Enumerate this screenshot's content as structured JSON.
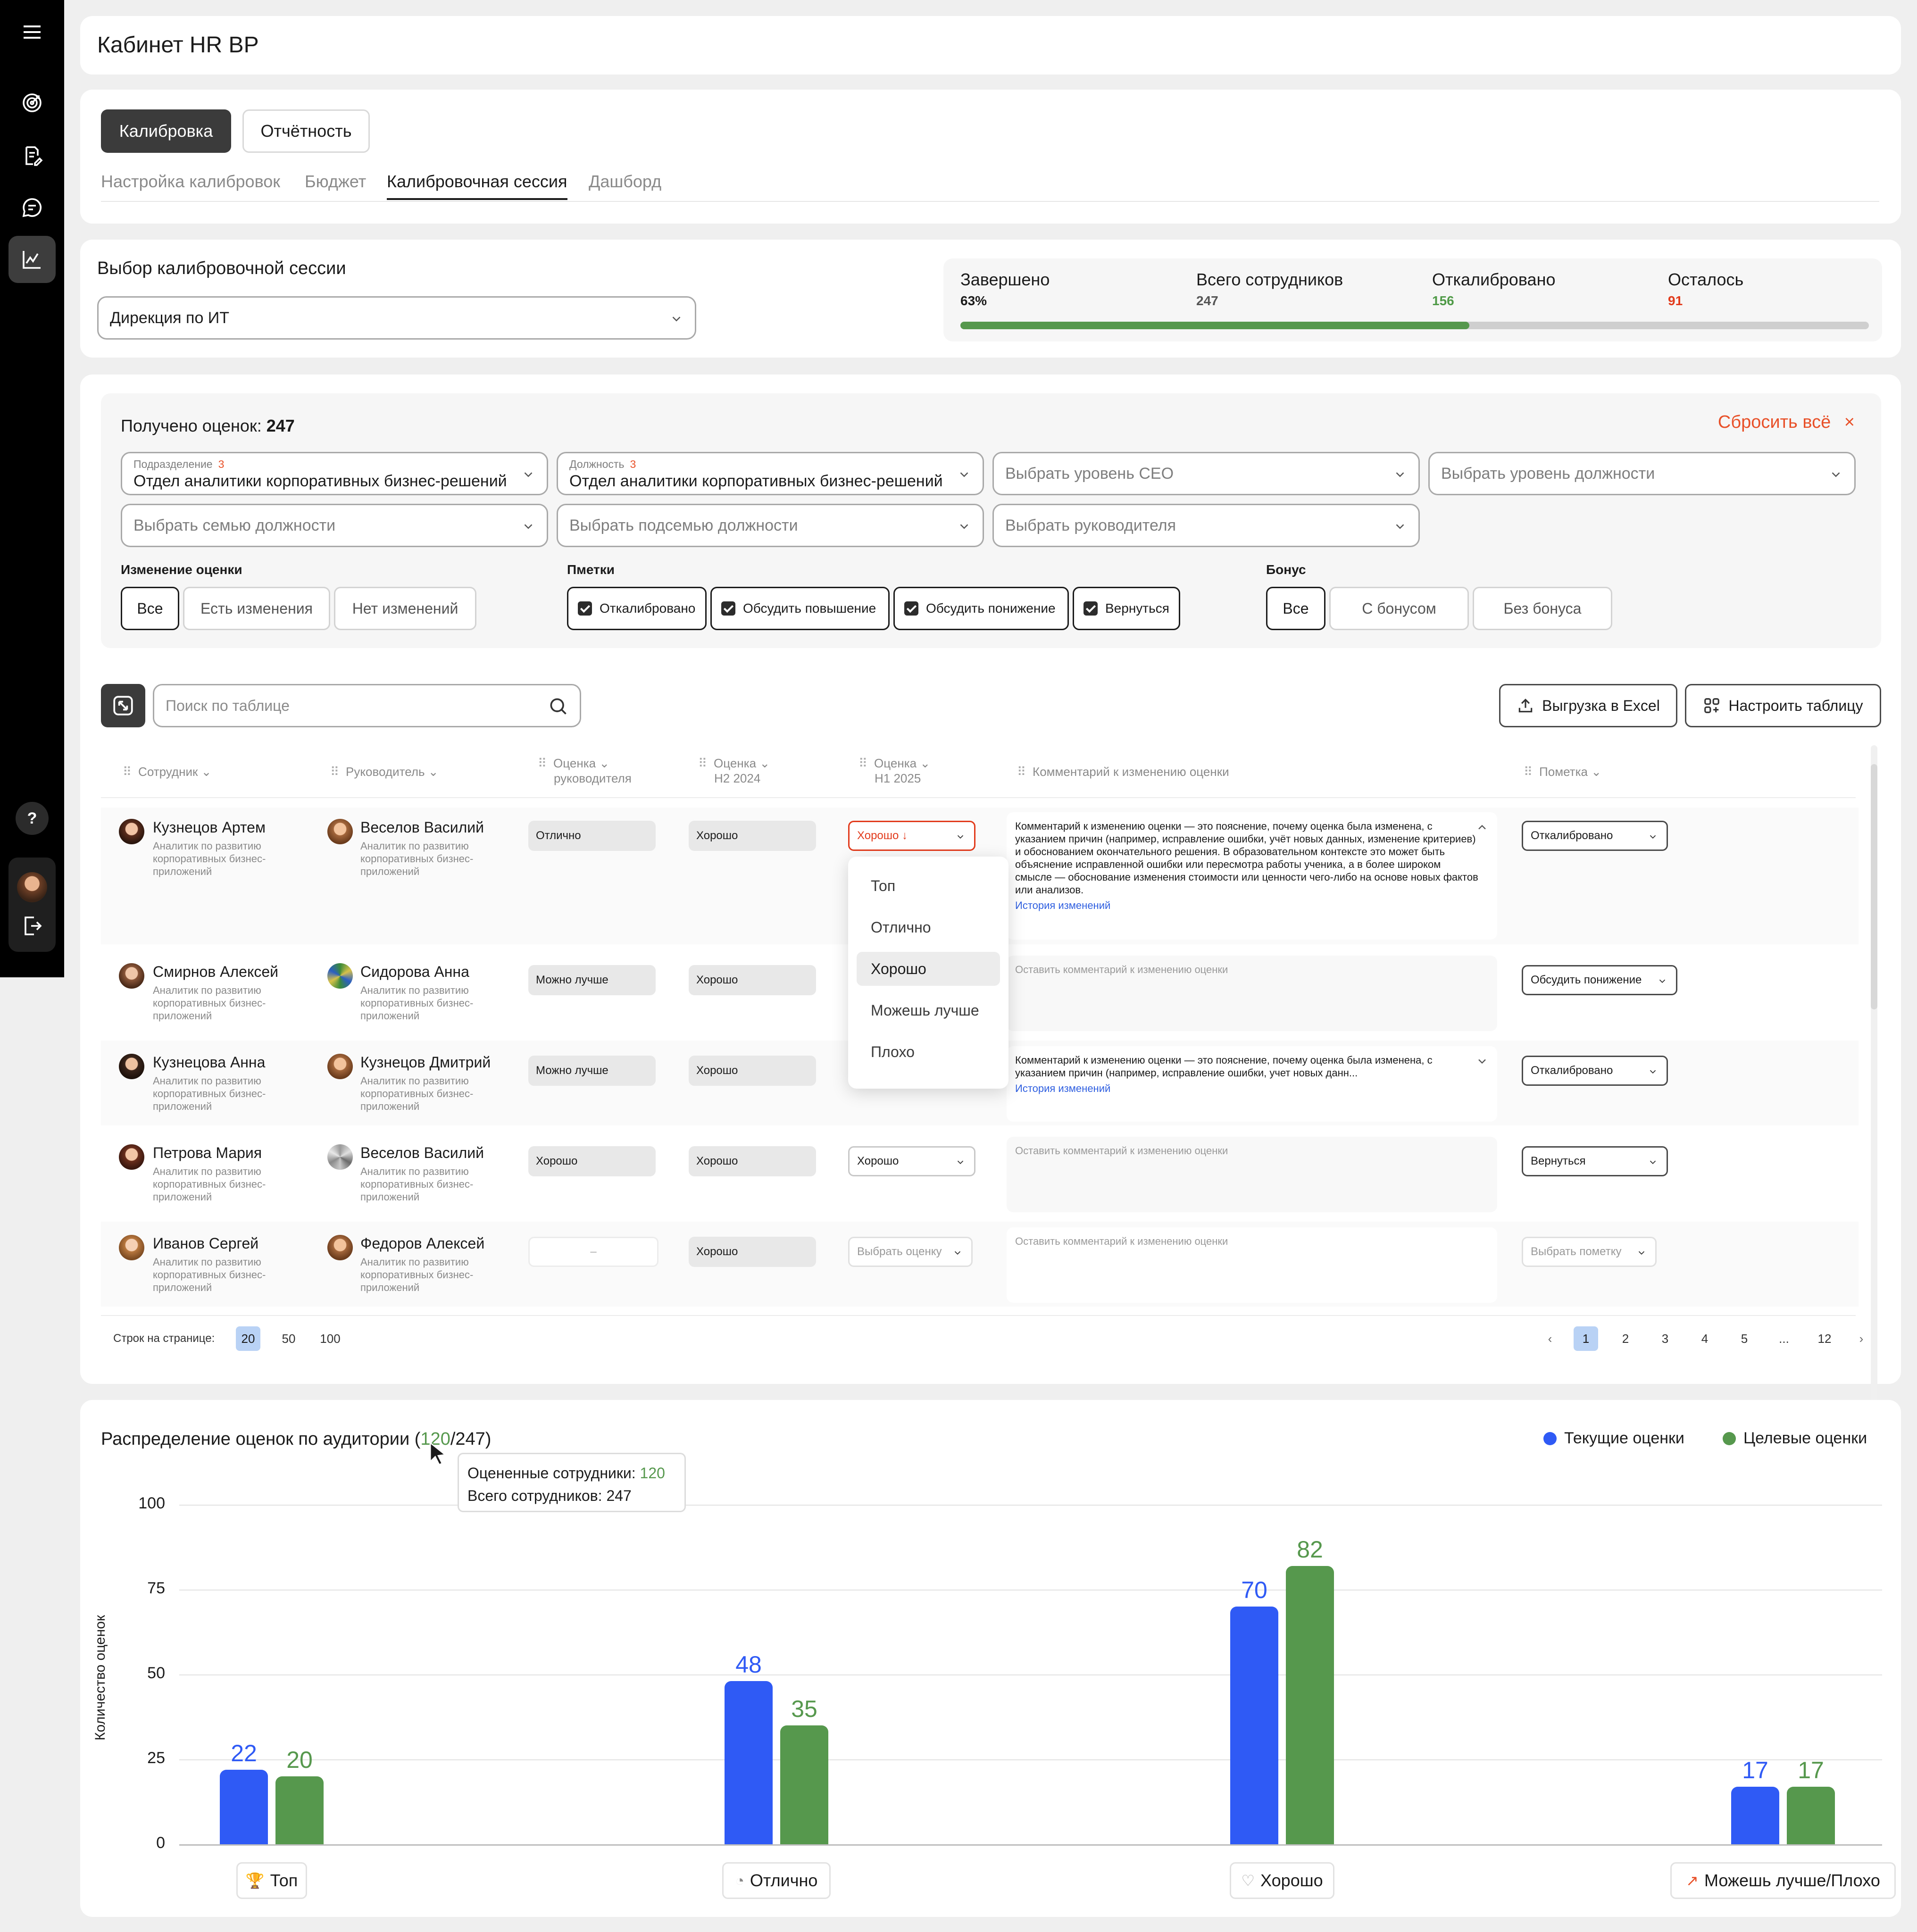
{
  "app": {
    "title": "Кабинет HR BP"
  },
  "sidebar": {
    "help": "?"
  },
  "tabs": {
    "primary": [
      "Калибровка",
      "Отчётность"
    ],
    "secondary": [
      "Настройка калибровок",
      "Бюджет",
      "Калибровочная сессия",
      "Дашборд"
    ]
  },
  "session": {
    "label": "Выбор калибровочной сессии",
    "value": "Дирекция по ИТ",
    "stats": [
      {
        "label": "Завершено",
        "value": "63%",
        "color": "#1b1b1b"
      },
      {
        "label": "Всего сотрудников",
        "value": "247",
        "color": "#555555"
      },
      {
        "label": "Откалибровано",
        "value": "156",
        "color": "#4f9a47"
      },
      {
        "label": "Осталось",
        "value": "91",
        "color": "#e23b1c"
      }
    ],
    "progress": 0.56
  },
  "filters": {
    "received_label": "Получено оценок:",
    "received_count": "247",
    "reset": "Сбросить всё",
    "reset_icon": "×",
    "division": {
      "label": "Подразделение",
      "count": "3",
      "value": "Отдел аналитики корпоративных бизнес-решений"
    },
    "position": {
      "label": "Должность",
      "count": "3",
      "value": "Отдел аналитики корпоративных бизнес-решений"
    },
    "ceo_level": "Выбрать уровень CEO",
    "pos_level": "Выбрать уровень должности",
    "family": "Выбрать семью должности",
    "subfamily": "Выбрать подсемью должности",
    "manager": "Выбрать руководителя",
    "change_group": {
      "title": "Изменение оценки",
      "options": [
        "Все",
        "Есть изменения",
        "Нет изменений"
      ]
    },
    "marks_group": {
      "title": "Пметки",
      "options": [
        "Откалиброванo",
        "Обсудить повышение",
        "Обсудить понижение",
        "Вернуться"
      ]
    },
    "bonus_group": {
      "title": "Бонус",
      "options": [
        "Все",
        "С бонусом",
        "Без бонуса"
      ]
    }
  },
  "toolbar": {
    "search_placeholder": "Поиск по таблице",
    "export": "Выгрузка в Excel",
    "configure": "Настроить таблицу"
  },
  "table": {
    "headers": {
      "employee": "Сотрудник",
      "manager": "Руководитель",
      "mgr_score_1": "Оценка",
      "mgr_score_2": "руководителя",
      "h2_1": "Оценка",
      "h2_2": "H2 2024",
      "h1_1": "Оценка",
      "h1_2": "H1 2025",
      "comment": "Комментарий к изменению оценки",
      "mark": "Пометка"
    },
    "rows": [
      {
        "name": "Кузнецов Артем",
        "role": "Аналитик по развитию корпоративных бизнес-приложений",
        "mgr": "Веселов Василий",
        "mgr_role": "Аналитик по развитию корпоративных бизнес-приложений",
        "mgr_score": "Отлично",
        "h2": "Хорошо",
        "h1": "Хорошо ↓",
        "comment": "Комментарий к изменению оценки — это пояснение, почему оценка была изменена, с указанием причин (например, исправление ошибки, учёт новых данных, изменение критериев) и обоснованием окончательного решения. В образовательном контексте это может быть объяснение исправленной ошибки или пересмотра работы ученика, а в более широком смысле — обоснование изменения стоимости или ценности чего-либо на основе новых фактов или анализов.",
        "history": "История изменений",
        "mark": "Откалибровано"
      },
      {
        "name": "Смирнов Алексей",
        "role": "Аналитик по развитию корпоративных бизнес-приложений",
        "mgr": "Сидорова Анна",
        "mgr_role": "Аналитик по развитию корпоративных бизнес-приложений",
        "mgr_score": "Можно лучше",
        "h2": "Хорошо",
        "h1": "",
        "comment": "Оставить комментарий к изменению оценки",
        "mark": "Обсудить понижение"
      },
      {
        "name": "Кузнецова Анна",
        "role": "Аналитик по развитию корпоративных бизнес-приложений",
        "mgr": "Кузнецов Дмитрий",
        "mgr_role": "Аналитик по развитию корпоративных бизнес-приложений",
        "mgr_score": "Можно лучше",
        "h2": "Хорошо",
        "h1": "",
        "comment": "Комментарий к изменению оценки — это пояснение, почему оценка была изменена, с указанием причин (например, исправление ошибки, учет новых данн...",
        "history": "История изменений",
        "mark": "Откалибровано"
      },
      {
        "name": "Петрова Мария",
        "role": "Аналитик по развитию корпоративных бизнес-приложений",
        "mgr": "Веселов Василий",
        "mgr_role": "Аналитик по развитию корпоративных бизнес-приложений",
        "mgr_score": "Хорошо",
        "h2": "Хорошо",
        "h1": "Хорошо",
        "comment": "Оставить комментарий к изменению оценки",
        "mark": "Вернуться"
      },
      {
        "name": "Иванов Сергей",
        "role": "Аналитик по развитию корпоративных бизнес-приложений",
        "mgr": "Федоров Алексей",
        "mgr_role": "Аналитик по развитию корпоративных бизнес-приложений",
        "mgr_score": "–",
        "h2": "Хорошо",
        "h1": "Выбрать оценку",
        "comment": "Оставить комментарий к изменению оценки",
        "mark": "Выбрать пометку"
      }
    ],
    "dropdown_options": [
      "Топ",
      "Отлично",
      "Хорошо",
      "Можешь лучше",
      "Плохо"
    ],
    "dropdown_selected": "Хорошо"
  },
  "pagination": {
    "label": "Строк на странице:",
    "sizes": [
      "20",
      "50",
      "100"
    ],
    "pages": [
      "1",
      "2",
      "3",
      "4",
      "5",
      "...",
      "12"
    ]
  },
  "chart_data": {
    "type": "bar",
    "title_prefix": "Распределение оценок по аудитории (",
    "title_count": "120",
    "title_suffix": "/247)",
    "ylabel": "Количество оценок",
    "ylim": [
      0,
      100
    ],
    "yticks": [
      "100",
      "75",
      "50",
      "25",
      "0"
    ],
    "categories": [
      "Топ",
      "Отлично",
      "Хорошо",
      "Можешь лучше/Плохо"
    ],
    "category_icons": [
      "trophy-icon",
      "fire-icon",
      "heart-icon",
      "arrow-up-right-icon"
    ],
    "series": [
      {
        "name": "Текущие оценки",
        "color": "#2f5af5",
        "values": [
          22,
          48,
          70,
          17
        ]
      },
      {
        "name": "Целевые оценки",
        "color": "#56984d",
        "values": [
          20,
          35,
          82,
          17
        ]
      }
    ],
    "tooltip": {
      "rated_label": "Оцененные сотрудники:",
      "rated_value": "120",
      "total_label": "Всего сотрудников:",
      "total_value": "247"
    }
  }
}
